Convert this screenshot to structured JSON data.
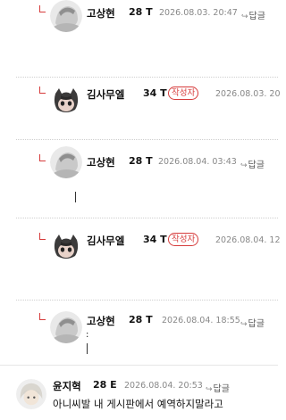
{
  "comments": [
    {
      "nick": "고상현",
      "level": "28 T",
      "badge": "",
      "date": "2026.08.03. 20:47",
      "reply": "답글",
      "text": ""
    },
    {
      "nick": "김사무엘",
      "level": "34 T",
      "badge": "작성자",
      "date": "2026.08.03. 20",
      "reply": "",
      "text": ""
    },
    {
      "nick": "고상현",
      "level": "28 T",
      "badge": "",
      "date": "2026.08.04. 03:43",
      "reply": "답글",
      "text": ""
    },
    {
      "nick": "김사무엘",
      "level": "34 T",
      "badge": "작성자",
      "date": "2026.08.04. 12",
      "reply": "",
      "text": ""
    },
    {
      "nick": "고상현",
      "level": "28 T",
      "badge": "",
      "date": "2026.08.04. 18:55",
      "reply": "답글",
      "text": ":"
    },
    {
      "nick": "윤지혁",
      "level": "28 E",
      "badge": "",
      "date": "2026.08.04. 20:53",
      "reply": "답글",
      "text": "아니씨발 내 게시판에서 예역하지말라고"
    }
  ]
}
